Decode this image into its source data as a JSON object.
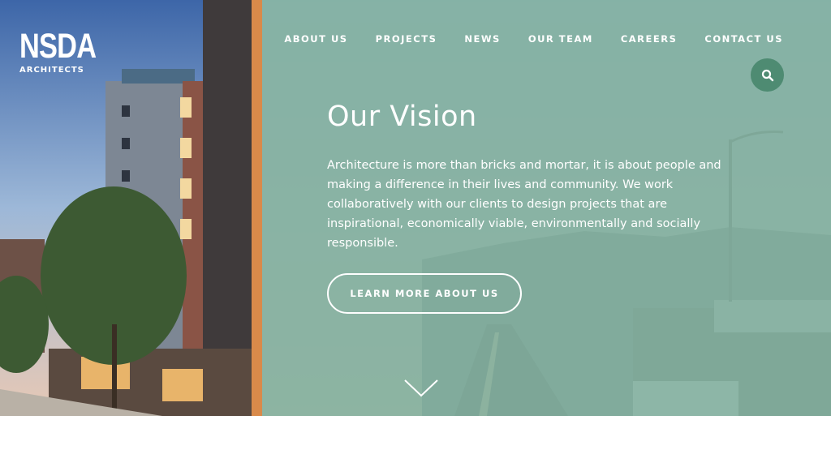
{
  "brand": {
    "name": "NSDA",
    "sub": "ARCHITECTS"
  },
  "nav": {
    "items": [
      {
        "label": "ABOUT US"
      },
      {
        "label": "PROJECTS"
      },
      {
        "label": "NEWS"
      },
      {
        "label": "OUR TEAM"
      },
      {
        "label": "CAREERS"
      },
      {
        "label": "CONTACT US"
      }
    ],
    "search_icon": "search-icon"
  },
  "hero": {
    "title": "Our Vision",
    "text": "Architecture is more than bricks and mortar, it is about people and making a difference in their lives and community. We work collaboratively with our clients to design projects that are inspirational, economically viable, environmentally and socially responsible.",
    "cta": "LEARN MORE ABOUT US",
    "scroll_icon": "chevron-down-icon"
  },
  "colors": {
    "overlay": "#84b2a1",
    "search_button": "#4e8b72",
    "text": "#ffffff"
  }
}
